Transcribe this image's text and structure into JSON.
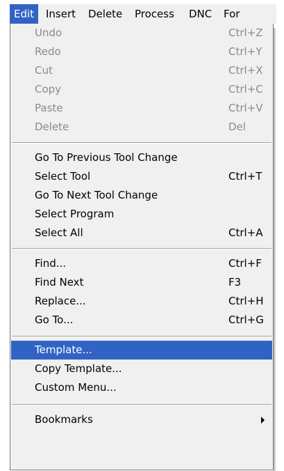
{
  "menubar": {
    "items": [
      "Edit",
      "Insert",
      "Delete",
      "Process",
      "DNC",
      "For"
    ]
  },
  "menu": {
    "undo": {
      "label": "Undo",
      "shortcut": "Ctrl+Z"
    },
    "redo": {
      "label": "Redo",
      "shortcut": "Ctrl+Y"
    },
    "cut": {
      "label": "Cut",
      "shortcut": "Ctrl+X"
    },
    "copy": {
      "label": "Copy",
      "shortcut": "Ctrl+C"
    },
    "paste": {
      "label": "Paste",
      "shortcut": "Ctrl+V"
    },
    "delete": {
      "label": "Delete",
      "shortcut": "Del"
    },
    "prev_tool_change": {
      "label": "Go To Previous Tool Change"
    },
    "select_tool": {
      "label": "Select Tool",
      "shortcut": "Ctrl+T"
    },
    "next_tool_change": {
      "label": "Go To Next Tool Change"
    },
    "select_program": {
      "label": "Select Program"
    },
    "select_all": {
      "label": "Select All",
      "shortcut": "Ctrl+A"
    },
    "find": {
      "label": "Find...",
      "shortcut": "Ctrl+F"
    },
    "find_next": {
      "label": "Find Next",
      "shortcut": "F3"
    },
    "replace": {
      "label": "Replace...",
      "shortcut": "Ctrl+H"
    },
    "go_to": {
      "label": "Go To...",
      "shortcut": "Ctrl+G"
    },
    "template": {
      "label": "Template..."
    },
    "copy_template": {
      "label": "Copy Template..."
    },
    "custom_menu": {
      "label": "Custom Menu..."
    },
    "bookmarks": {
      "label": "Bookmarks"
    }
  },
  "colors": {
    "highlight": "#3163c5",
    "disabled_text": "#8a8a8a",
    "menu_background": "#f0f0f0"
  }
}
